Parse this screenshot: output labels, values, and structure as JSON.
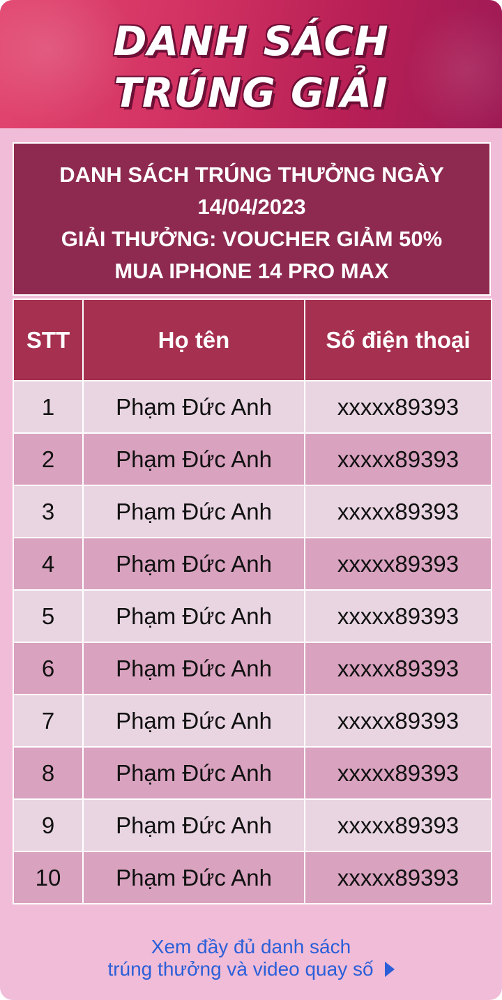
{
  "banner": {
    "title_line1": "DANH SÁCH",
    "title_line2": "TRÚNG GIẢI"
  },
  "caption": {
    "line1": "DANH SÁCH TRÚNG THƯỞNG NGÀY",
    "line2": "14/04/2023",
    "line3": "GIẢI THƯỞNG: VOUCHER GIẢM 50%",
    "line4": "MUA IPHONE 14 PRO MAX"
  },
  "table": {
    "headers": [
      "STT",
      "Họ tên",
      "Số điện thoại"
    ],
    "rows": [
      [
        "1",
        "Phạm Đức Anh",
        "xxxxx89393"
      ],
      [
        "2",
        "Phạm Đức Anh",
        "xxxxx89393"
      ],
      [
        "3",
        "Phạm Đức Anh",
        "xxxxx89393"
      ],
      [
        "4",
        "Phạm Đức Anh",
        "xxxxx89393"
      ],
      [
        "5",
        "Phạm Đức Anh",
        "xxxxx89393"
      ],
      [
        "6",
        "Phạm Đức Anh",
        "xxxxx89393"
      ],
      [
        "7",
        "Phạm Đức Anh",
        "xxxxx89393"
      ],
      [
        "8",
        "Phạm Đức Anh",
        "xxxxx89393"
      ],
      [
        "9",
        "Phạm Đức Anh",
        "xxxxx89393"
      ],
      [
        "10",
        "Phạm Đức Anh",
        "xxxxx89393"
      ]
    ]
  },
  "footer": {
    "link_line1": "Xem đầy đủ danh sách",
    "link_line2": "trúng thưởng và video quay số",
    "link_icon": "play-arrow-icon"
  },
  "colors": {
    "banner": "#d33363",
    "caption_bg": "#8e2a4f",
    "header_bg": "#a6304f",
    "row_light": "#e9d5e1",
    "row_dark": "#d9a2bf",
    "page_bg": "#f0bcd7",
    "link": "#2a5fd8"
  }
}
